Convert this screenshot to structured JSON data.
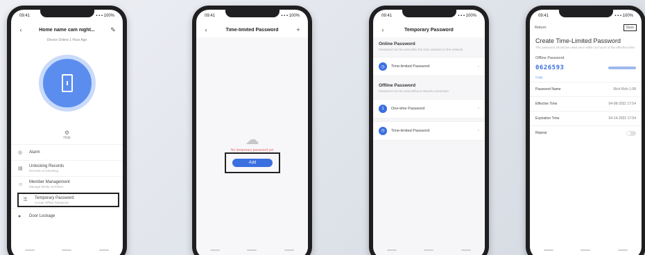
{
  "screen1": {
    "status_left": "09:41",
    "status_right": "▪ ▪ ▪ 100%",
    "title": "Home name cam night...",
    "subtitle": "Device Online 1 Hour Ago",
    "center_label": "Help",
    "menu": [
      {
        "label": "Alarm",
        "sub": ""
      },
      {
        "label": "Unlocking Records",
        "sub": "Records of unlocking"
      },
      {
        "label": "Member Management",
        "sub": "Manage family members"
      },
      {
        "label": "Temporary Password",
        "sub": "Create Offline Password"
      },
      {
        "label": "Door Lockage",
        "sub": ""
      }
    ]
  },
  "screen2": {
    "status_left": "09:41",
    "status_right": "▪ ▪ ▪ 100%",
    "title": "Time-limited Password",
    "empty_text": "No temporary password yet",
    "add_label": "Add"
  },
  "screen3": {
    "status_left": "09:41",
    "status_right": "▪ ▪ ▪ 100%",
    "title": "Temporary Password",
    "online_title": "Online Password",
    "online_desc": "Password can be used after the lock connects to the network",
    "online_items": [
      "Time-limited Password"
    ],
    "offline_title": "Offline Password",
    "offline_desc": "Password can be used without network connection",
    "offline_items": [
      "One-time Password",
      "Time-limited Password"
    ]
  },
  "screen4": {
    "status_left": "09:41",
    "status_right": "▪ ▪ ▪ 100%",
    "back_label": "Return",
    "save_label": "Save",
    "title": "Create Time-Limited Password",
    "desc": "The password should be used once within 24 hours of the effective time.",
    "pwd_label": "Offline Password",
    "pwd_value": "0626593",
    "pwd_tag": "Copy",
    "fields": [
      {
        "label": "Password Name",
        "value": "Rich Rich 1:08"
      },
      {
        "label": "Effective Time",
        "value": "04-08-2022 17:54"
      },
      {
        "label": "Expiration Time",
        "value": "04-14-2022 17:54"
      }
    ],
    "repeat_label": "Repeat"
  }
}
